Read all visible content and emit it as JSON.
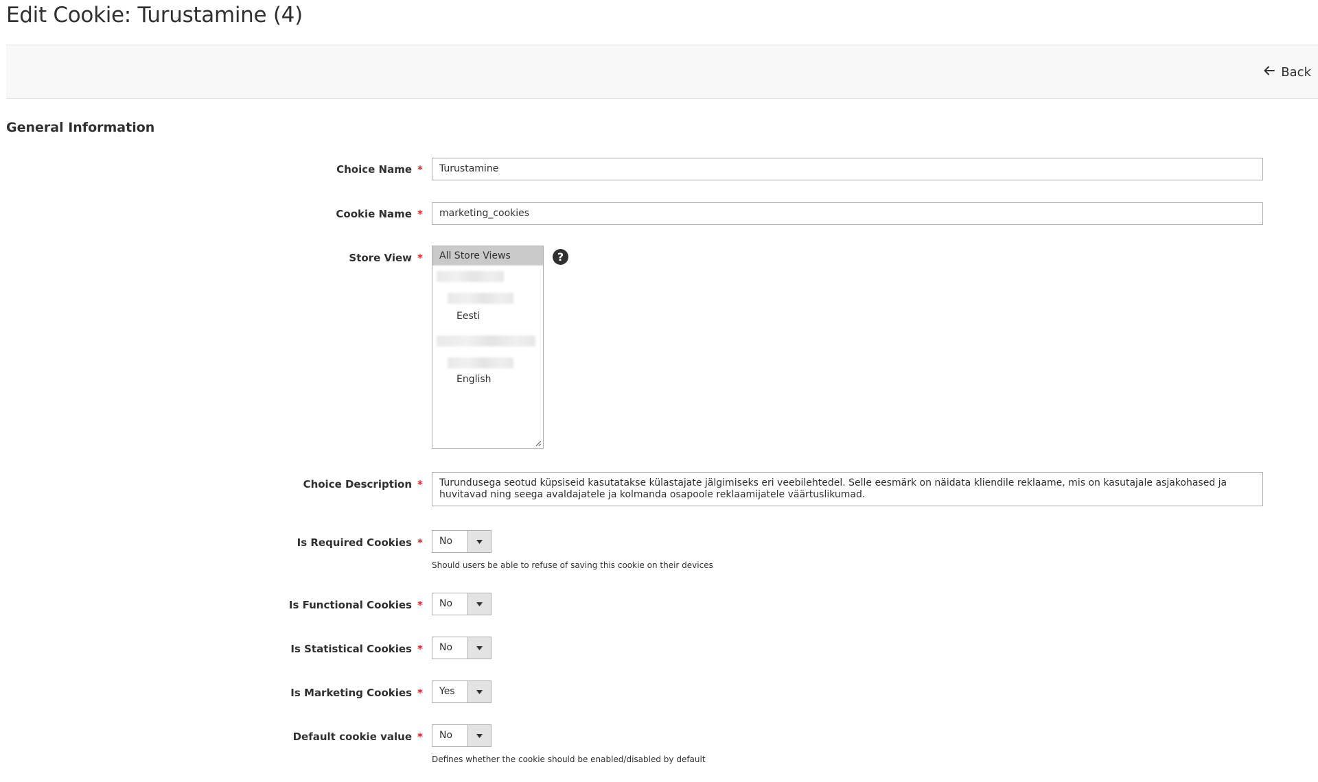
{
  "page": {
    "title": "Edit Cookie: Turustamine (4)"
  },
  "actions": {
    "back_label": "Back"
  },
  "section": {
    "title": "General Information"
  },
  "fields": {
    "choice_name": {
      "label": "Choice Name",
      "value": "Turustamine"
    },
    "cookie_name": {
      "label": "Cookie Name",
      "value": "marketing_cookies"
    },
    "store_view": {
      "label": "Store View",
      "selected": "All Store Views",
      "options": [
        "All Store Views",
        "Eesti",
        "English"
      ]
    },
    "choice_description": {
      "label": "Choice Description",
      "value": "Turundusega seotud küpsiseid kasutatakse külastajate jälgimiseks eri veebilehtedel. Selle eesmärk on näidata kliendile reklaame, mis on kasutajale asjakohased ja huvitavad ning seega avaldajatele ja kolmanda osapoole reklaamijatele väärtuslikumad."
    },
    "is_required": {
      "label": "Is Required Cookies",
      "value": "No",
      "note": "Should users be able to refuse of saving this cookie on their devices"
    },
    "is_functional": {
      "label": "Is Functional Cookies",
      "value": "No"
    },
    "is_statistical": {
      "label": "Is Statistical Cookies",
      "value": "No"
    },
    "is_marketing": {
      "label": "Is Marketing Cookies",
      "value": "Yes"
    },
    "default_value": {
      "label": "Default cookie value",
      "value": "No",
      "note": "Defines whether the cookie should be enabled/disabled by default"
    }
  },
  "required_mark": "*",
  "help_mark": "?",
  "colors": {
    "required": "#e22626",
    "selected_option": "#cacaca",
    "border": "#adadad"
  }
}
